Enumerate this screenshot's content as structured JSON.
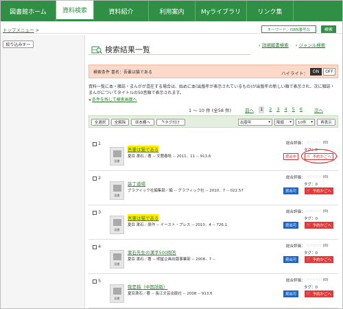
{
  "nav": {
    "tabs": [
      {
        "label": "図書館ホーム"
      },
      {
        "label": "資料検索"
      },
      {
        "label": "資料紹介"
      },
      {
        "label": "利用案内"
      },
      {
        "label": "Myライブラリ"
      },
      {
        "label": "リンク集"
      }
    ],
    "active_index": 1
  },
  "breadcrumb": {
    "link": "トップメニュー",
    "sep": ">"
  },
  "keyword": {
    "label": "キーワード、ISBN番号な",
    "search": "検索"
  },
  "sidebar": {
    "refine_label": "絞り込みキー"
  },
  "results": {
    "title": "検索結果一覧",
    "links": {
      "detail": "詳細蔵書検索",
      "genre": "ジャンル検索"
    },
    "condition": {
      "text": "検索条件 書名：吾輩は猫である",
      "highlight_label": "ハイライト：",
      "on": "ON",
      "off": "OFF"
    },
    "description": "資料一覧に本・雑誌・まんがが混在する場合は、始めに本(出版年が表示されているもの)が出版年の新しい順で表示され、次に雑誌・まんがについてタイトルの50音順で表示されます。",
    "condition_link": "条件を残して検索画面へ",
    "count": "1 〜 10 件 (全58 件)",
    "pager": {
      "prev": "前へ",
      "pages": [
        "1",
        "2",
        "3",
        "4",
        "5",
        "6"
      ],
      "next": "次へ"
    },
    "toolbar": {
      "select_all": "全選択",
      "deselect_all": "全解除",
      "to_shelf": "本棚へ",
      "tag": "タグ付け",
      "sort_field": "出版年",
      "sort_order": "降順",
      "per_page": "10件",
      "redisplay": "再表示"
    },
    "items": [
      {
        "num": "1",
        "title": "吾輩は猫である",
        "highlight": true,
        "meta": "夏目 漱石／著 -- 文藝春秋 -- 2011．11 -- 913.6",
        "rating_label": "総合評価：",
        "rating": "(0)",
        "tag": "タグ：0",
        "status": "貸出中",
        "status_type": "out",
        "reserve": "予約かごへ"
      },
      {
        "num": "2",
        "title": "装丁道場",
        "highlight": false,
        "meta": "グラフィック社編集部／編 -- グラフィック社 -- 2010．7 -- 022.57",
        "rating_label": "総合評価：",
        "rating": "(0)",
        "tag": "タグ：0",
        "status": "貸出可",
        "status_type": "avail",
        "reserve": "予約かごへ"
      },
      {
        "num": "3",
        "title": "吾輩は猫である",
        "highlight": true,
        "meta": "夏目 漱石／原作 -- イースト・プレス -- 2010．4 -- 726.1",
        "rating_label": "総合評価：",
        "rating": "(0)",
        "tag": "タグ：0",
        "status": "貸出可",
        "status_type": "avail",
        "reserve": "予約かごへ"
      },
      {
        "num": "4",
        "title": "漱石先生の漢字500問答",
        "highlight": false,
        "meta": "夏目 漱石／著 -- 明星企画出版事業部 -- 2008．7 --",
        "rating_label": "総合評価：",
        "rating": "(0)",
        "tag": "タグ：0",
        "status": "貸出可",
        "status_type": "avail",
        "reserve": "予約かごへ"
      },
      {
        "num": "5",
        "title": "我是猫（中国語版）",
        "highlight": false,
        "meta": "夏目漱石／著 -- 長江文芸出版社 -- 2008 -- 913.6",
        "rating_label": "総合評価：",
        "rating": "(0)",
        "tag": "タグ：0",
        "status": "貸出可",
        "status_type": "avail",
        "reserve": "予約かごへ"
      }
    ],
    "thumb_caption": "図書"
  },
  "colors": {
    "brand": "#2e8f45",
    "condition_bg": "#fcd9c9",
    "reserve": "#e23a3a",
    "available": "#1e62c4"
  }
}
